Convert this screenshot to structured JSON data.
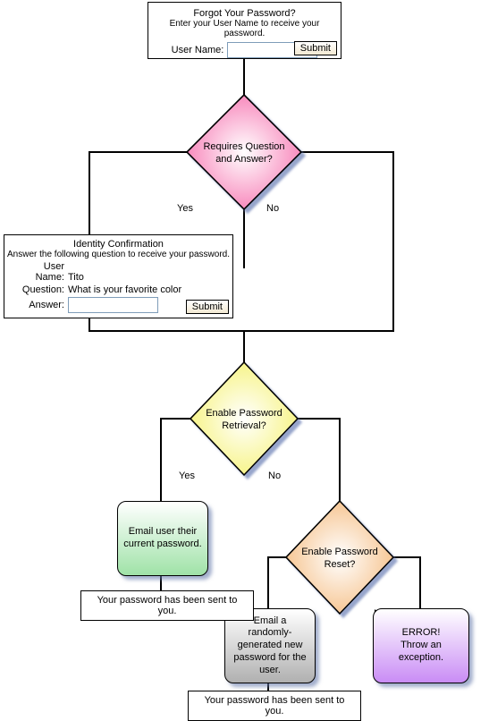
{
  "forgot": {
    "title": "Forgot Your Password?",
    "subtitle": "Enter your User Name to receive your password.",
    "username_label": "User Name:",
    "username_value": "",
    "submit": "Submit"
  },
  "diamond1": "Requires Question\nand Answer?",
  "diamond2": "Enable Password\nRetrieval?",
  "diamond3": "Enable Password\nReset?",
  "branch": {
    "yes": "Yes",
    "no": "No"
  },
  "identity": {
    "title": "Identity Confirmation",
    "subtitle": "Answer the following question to receive your password.",
    "username_label": "User Name:",
    "username_value": "Tito",
    "question_label": "Question:",
    "question_value": "What is your favorite color",
    "answer_label": "Answer:",
    "answer_value": "",
    "submit": "Submit"
  },
  "box_email_current": "Email user their\ncurrent password.",
  "box_email_random": "Email a randomly-\ngenerated new\npassword for the\nuser.",
  "box_error": "ERROR!\nThrow an exception.",
  "msg_sent": "Your password has been sent to you."
}
